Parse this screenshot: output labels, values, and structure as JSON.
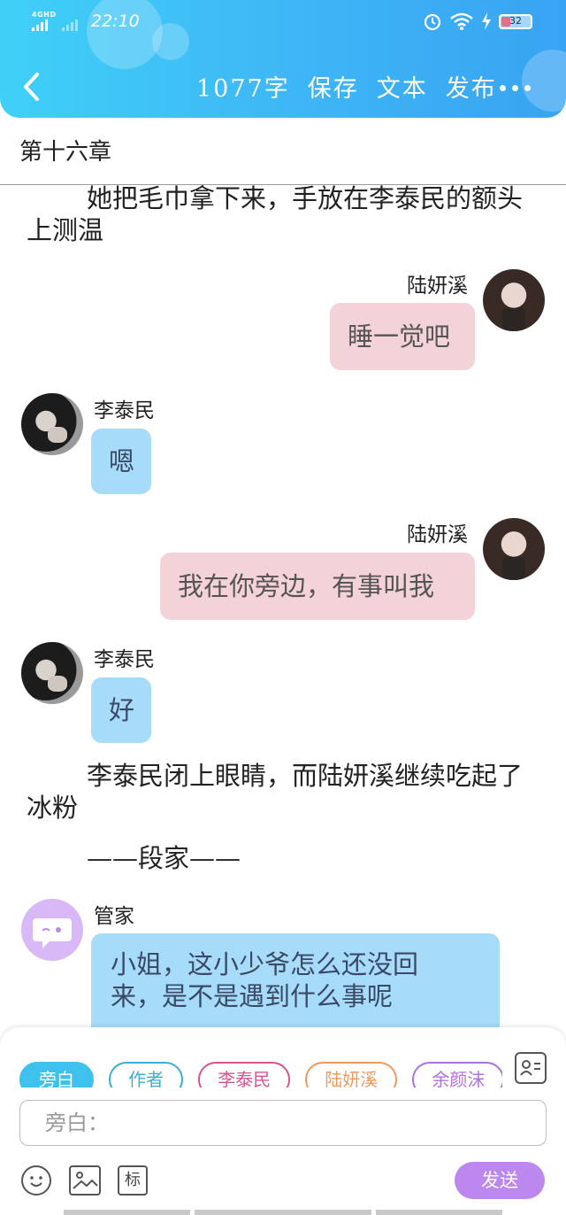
{
  "status_bar": {
    "network": "4GHD",
    "time": "22:10",
    "battery": "32"
  },
  "header": {
    "word_count": "1077字",
    "save": "保存",
    "text": "文本",
    "publish": "发布"
  },
  "chapter": {
    "title": "第十六章"
  },
  "story": {
    "p1": "她把毛巾拿下来，手放在李泰民的额头上测温",
    "msg1": {
      "speaker": "陆妍溪",
      "text": "睡一觉吧"
    },
    "msg2": {
      "speaker": "李泰民",
      "text": "嗯"
    },
    "msg3": {
      "speaker": "陆妍溪",
      "text": "我在你旁边，有事叫我"
    },
    "msg4": {
      "speaker": "李泰民",
      "text": "好"
    },
    "p2": "李泰民闭上眼睛，而陆妍溪继续吃起了冰粉",
    "p3": "——段家——",
    "msg5": {
      "speaker": "管家",
      "text_line1": "小姐，这小少爷怎么还没回",
      "text_line2": "来，是不是遇到什么事呢"
    }
  },
  "composer": {
    "chips": [
      "旁白",
      "作者",
      "李泰民",
      "陆妍溪",
      "余颜沫"
    ],
    "chip_colors": [
      "#3ec1ec",
      "#3aaed6",
      "#d85490",
      "#ee9a5e",
      "#b070e0"
    ],
    "input_placeholder": "旁白：",
    "tool_tag": "标",
    "send": "发送"
  },
  "colors": {
    "header_gradient_start": "#3fd0f7",
    "header_gradient_end": "#38a3f2",
    "pink_bubble": "#f4d3d8",
    "blue_bubble": "#a7dbfa",
    "send_button": "#bc88ee"
  }
}
